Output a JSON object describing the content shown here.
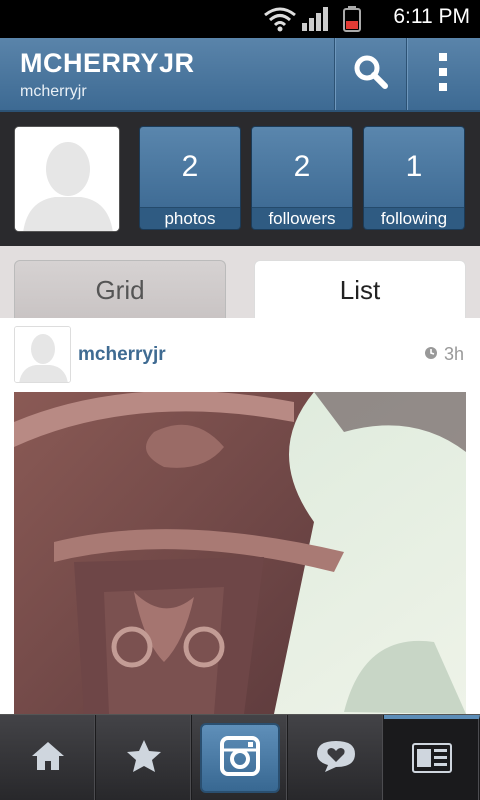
{
  "status_bar": {
    "time": "6:11 PM",
    "icons": [
      "wifi-icon",
      "signal-icon",
      "battery-icon"
    ],
    "battery_color": "#e23b35"
  },
  "header": {
    "title": "MCHERRYJR",
    "subtitle": "mcherryjr",
    "actions": [
      "search-icon",
      "overflow-menu-icon"
    ]
  },
  "profile": {
    "stats": [
      {
        "count": "2",
        "label": "photos"
      },
      {
        "count": "2",
        "label": "followers"
      },
      {
        "count": "1",
        "label": "following"
      }
    ]
  },
  "tabs": [
    {
      "label": "Grid",
      "selected": false
    },
    {
      "label": "List",
      "selected": true
    }
  ],
  "post": {
    "username": "mcherryjr",
    "time": "3h"
  },
  "bottom_nav": [
    "home-icon",
    "star-icon",
    "camera-icon",
    "speech-heart-icon",
    "news-feed-icon"
  ],
  "colors": {
    "accent": "#4a77a0",
    "dark": "#2a2a2d",
    "username": "#3f6b92"
  }
}
